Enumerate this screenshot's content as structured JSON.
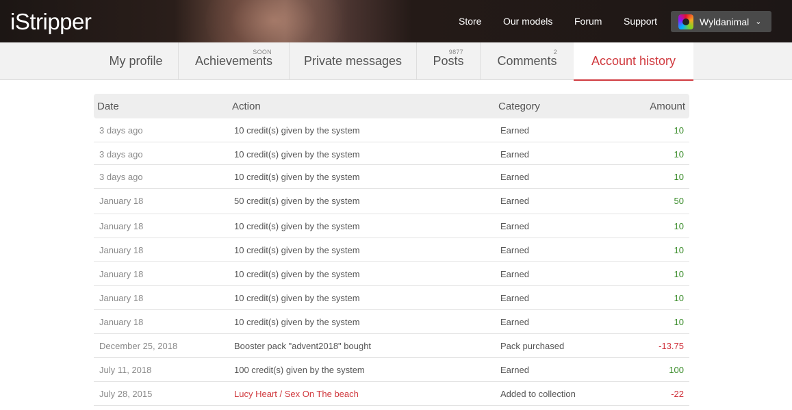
{
  "header": {
    "logo_text": "iStripper",
    "nav": [
      {
        "label": "Store"
      },
      {
        "label": "Our models"
      },
      {
        "label": "Forum"
      },
      {
        "label": "Support"
      }
    ],
    "user": {
      "name": "Wyldanimal"
    }
  },
  "tabs": [
    {
      "label": "My profile",
      "badge": ""
    },
    {
      "label": "Achievements",
      "badge": "SOON"
    },
    {
      "label": "Private messages",
      "badge": ""
    },
    {
      "label": "Posts",
      "badge": "9877"
    },
    {
      "label": "Comments",
      "badge": "2"
    },
    {
      "label": "Account history",
      "badge": ""
    }
  ],
  "active_tab": "Account history",
  "colors": {
    "accent": "#d0393e",
    "positive": "#3a8c2a",
    "negative": "#d0303a"
  },
  "table": {
    "headers": {
      "date": "Date",
      "action": "Action",
      "category": "Category",
      "amount": "Amount"
    },
    "rows": [
      {
        "date": "3 days ago",
        "action": "10 credit(s) given by the system",
        "category": "Earned",
        "amount": "10"
      },
      {
        "date": "3 days ago",
        "action": "10 credit(s) given by the system",
        "category": "Earned",
        "amount": "10"
      },
      {
        "date": "3 days ago",
        "action": "10 credit(s) given by the system",
        "category": "Earned",
        "amount": "10"
      },
      {
        "date": "January 18",
        "action": "50 credit(s) given by the system",
        "category": "Earned",
        "amount": "50"
      },
      {
        "date": "January 18",
        "action": "10 credit(s) given by the system",
        "category": "Earned",
        "amount": "10"
      },
      {
        "date": "January 18",
        "action": "10 credit(s) given by the system",
        "category": "Earned",
        "amount": "10"
      },
      {
        "date": "January 18",
        "action": "10 credit(s) given by the system",
        "category": "Earned",
        "amount": "10"
      },
      {
        "date": "January 18",
        "action": "10 credit(s) given by the system",
        "category": "Earned",
        "amount": "10"
      },
      {
        "date": "January 18",
        "action": "10 credit(s) given by the system",
        "category": "Earned",
        "amount": "10"
      },
      {
        "date": "December 25, 2018",
        "action": "Booster pack \"advent2018\" bought",
        "category": "Pack purchased",
        "amount": "-13.75"
      },
      {
        "date": "July 11, 2018",
        "action": "100 credit(s) given by the system",
        "category": "Earned",
        "amount": "100"
      },
      {
        "date": "July 28, 2015",
        "action": "Lucy Heart / Sex On The beach",
        "category": "Added to collection",
        "amount": "-22",
        "action_is_link": true
      }
    ]
  }
}
